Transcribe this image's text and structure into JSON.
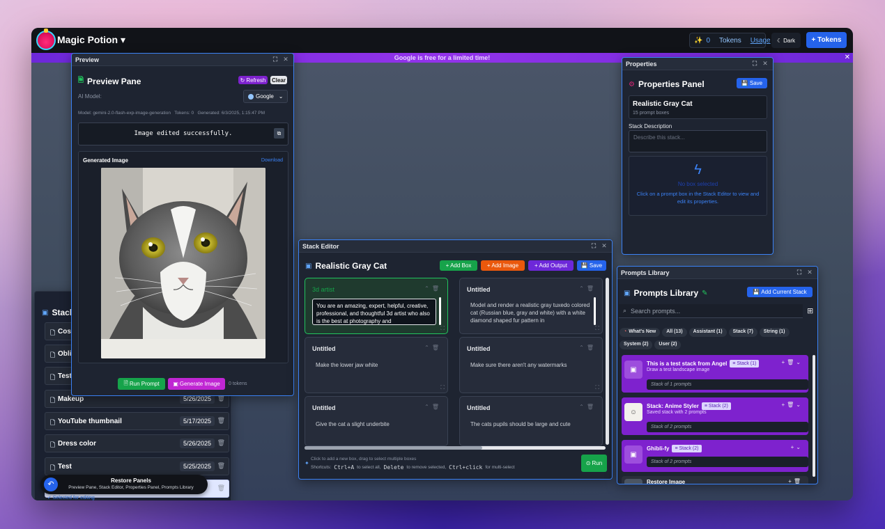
{
  "app": {
    "title": "Magic Potion ▾",
    "tokens_count": "0",
    "tokens_label": "Tokens",
    "usage_label": "Usage",
    "dark_label": "Dark",
    "tokens_button": "+ Tokens",
    "banner": "Google is free for a limited time!"
  },
  "stacks": {
    "title": "Stack",
    "rows": [
      {
        "label": "Costu",
        "date": ""
      },
      {
        "label": "Oblivi",
        "date": ""
      },
      {
        "label": "Test",
        "date": ""
      },
      {
        "label": "Makeup",
        "date": "5/26/2025"
      },
      {
        "label": "YouTube thumbnail",
        "date": "5/17/2025"
      },
      {
        "label": "Dress color",
        "date": "5/26/2025"
      },
      {
        "label": "Test",
        "date": "5/25/2025"
      }
    ],
    "selected_note": "✓ Selected for editing"
  },
  "restore": {
    "title": "Restore Panels",
    "sub": "Preview Pane, Stack Editor, Properties Panel, Prompts Library"
  },
  "preview": {
    "window_title": "Preview",
    "title": "Preview Pane",
    "refresh": "Refresh",
    "clear": "Clear",
    "ai_model_label": "AI Model:",
    "model_value": "Google",
    "meta": "Model: gemini-2.0-flash-exp-image-generation   Tokens: 0   Generated: 6/3/2025, 1:15:47 PM",
    "output": "Image edited successfully.",
    "gen_image_label": "Generated Image",
    "download": "Download",
    "run_prompt": "Run Prompt",
    "generate_image": "Generate Image",
    "tokens_note": "0 tokens"
  },
  "editor": {
    "window_title": "Stack Editor",
    "title": "Realistic Gray Cat",
    "add_box": "+ Add Box",
    "add_image": "+ Add Image",
    "add_output": "+ Add Output",
    "save": "Save",
    "boxes": [
      {
        "title": "3d artist",
        "text": "You are an amazing, expert, helpful, creative, professional, and thoughtful 3d artist who also is the best at photography and"
      },
      {
        "title": "Untitled",
        "text": "Model and render a realistic gray tuxedo colored cat (Russian blue, gray and white) with a white diamond shaped fur pattern in"
      },
      {
        "title": "Untitled",
        "text": "Make the lower jaw white"
      },
      {
        "title": "Untitled",
        "text": "Make sure there aren't any watermarks"
      },
      {
        "title": "Untitled",
        "text": "Give the cat a slight underbite"
      },
      {
        "title": "Untitled",
        "text": "The cats pupils should be large and cute"
      }
    ],
    "hint": "Click to add a new box, drag to select multiple boxes",
    "shortcuts_label": "Shortcuts:",
    "k1": "Ctrl+A",
    "t1": "to select all,",
    "k2": "Delete",
    "t2": "to remove selected,",
    "k3": "Ctrl+click",
    "t3": "for multi-select",
    "run": "Run"
  },
  "properties": {
    "window_title": "Properties",
    "title": "Properties Panel",
    "save": "Save",
    "stack_name": "Realistic Gray Cat",
    "stack_count": "15 prompt boxes",
    "desc_label": "Stack Description",
    "desc_placeholder": "Describe this stack...",
    "none_title": "No box selected",
    "none_text": "Click on a prompt box in the Stack Editor to view and edit its properties."
  },
  "library": {
    "window_title": "Prompts Library",
    "title": "Prompts Library",
    "add_current": "Add Current Stack",
    "search_placeholder": "Search prompts...",
    "chips": [
      "What's New",
      "All (13)",
      "Assistant (1)",
      "Stack (7)",
      "String (1)",
      "System (2)",
      "User (2)"
    ],
    "items": [
      {
        "name": "This is a test stack from Angel",
        "tag": "≡ Stack (1)",
        "sub": "Draw a test landscape image",
        "count": "Stack of 1 prompts"
      },
      {
        "name": "Stack: Anime Styler",
        "tag": "≡ Stack (2)",
        "sub": "Saved stack with 2 prompts",
        "count": "Stack of 2 prompts"
      },
      {
        "name": "Ghibli-fy",
        "tag": "≡ Stack (2)",
        "sub": "",
        "count": "Stack of 2 prompts"
      },
      {
        "name": "Restore Image",
        "tag": "",
        "sub": "",
        "count": ""
      }
    ]
  },
  "colors": {
    "accent": "#3b82f6",
    "green": "#16a34a",
    "orange": "#ea580c",
    "purple": "#7e22ce"
  }
}
